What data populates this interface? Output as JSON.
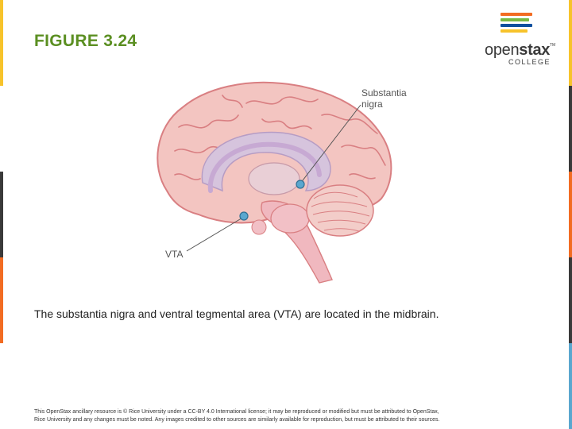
{
  "slide": {
    "title": "FIGURE 3.24",
    "caption": "The substantia nigra and ventral tegmental area (VTA) are located in the midbrain.",
    "footer_line1": "This OpenStax ancillary resource is © Rice University under a CC-BY 4.0 International license; it may be reproduced or modified but must be attributed to OpenStax,",
    "footer_line2": "Rice University and any changes must be noted. Any images credited to other sources are similarly available for reproduction, but must be attributed to their sources."
  },
  "logo": {
    "word_light": "open",
    "word_bold": "stax",
    "tm": "TM",
    "sub": "COLLEGE",
    "bar_colors": [
      "#f26c22",
      "#78b843",
      "#0e4f9e",
      "#f7c32b",
      "#3a3a3a"
    ]
  },
  "diagram": {
    "label_substantia_line1": "Substantia",
    "label_substantia_line2": "nigra",
    "label_vta": "VTA"
  },
  "colors": {
    "title": "#5b8f22",
    "brain": "#f3c5c1",
    "brain_outline": "#d97f82",
    "inner": "#d6c4dd",
    "marker": "#5aa7cf",
    "edge_strips": [
      "#f7c32b",
      "#3a3a3a",
      "#f26c22",
      "#5aa7cf",
      "#3a3a3a"
    ]
  }
}
